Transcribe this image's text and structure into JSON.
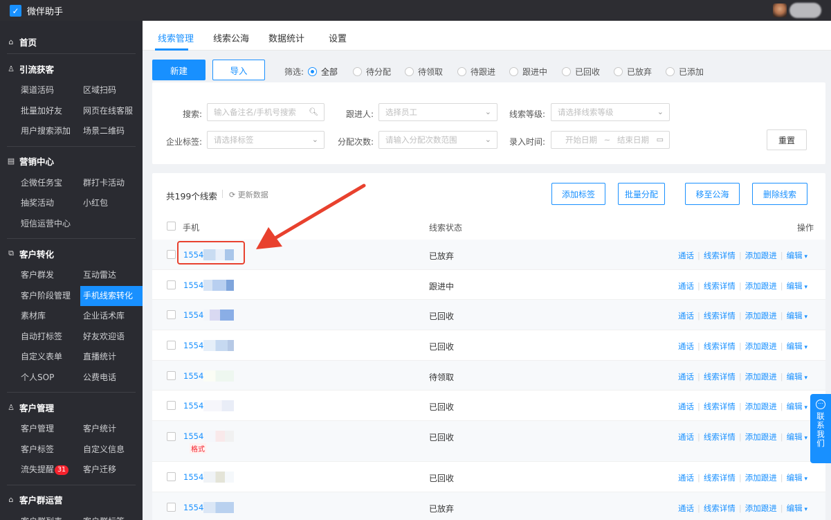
{
  "app": {
    "title": "微伴助手"
  },
  "sidebar": {
    "sections": [
      {
        "title": "首页",
        "icon": "home-icon",
        "items": []
      },
      {
        "title": "引流获客",
        "icon": "user-add-icon",
        "items": [
          "渠道活码",
          "区域扫码",
          "批量加好友",
          "网页在线客服",
          "用户搜索添加",
          "场景二维码"
        ]
      },
      {
        "title": "营销中心",
        "icon": "calendar-icon",
        "items": [
          "企微任务宝",
          "群打卡活动",
          "抽奖活动",
          "小红包",
          "短信运营中心"
        ]
      },
      {
        "title": "客户转化",
        "icon": "convert-icon",
        "items": [
          "客户群发",
          "互动雷达",
          "客户阶段管理",
          "手机线索转化",
          "素材库",
          "企业话术库",
          "自动打标签",
          "好友欢迎语",
          "自定义表单",
          "直播统计",
          "个人SOP",
          "公费电话"
        ]
      },
      {
        "title": "客户管理",
        "icon": "customer-icon",
        "items": [
          "客户管理",
          "客户统计",
          "客户标签",
          "自定义信息",
          "流失提醒",
          "客户迁移"
        ]
      },
      {
        "title": "客户群运营",
        "icon": "group-icon",
        "items": [
          "客户群列表",
          "客户群标签"
        ]
      }
    ],
    "active_item": "手机线索转化",
    "badge_item": "流失提醒",
    "badge_count": "31"
  },
  "tabs": [
    "线索管理",
    "线索公海",
    "数据统计",
    "设置"
  ],
  "toolbar": {
    "new_label": "新建",
    "import_label": "导入",
    "filter_label": "筛选:",
    "filters": [
      "全部",
      "待分配",
      "待领取",
      "待跟进",
      "跟进中",
      "已回收",
      "已放弃",
      "已添加"
    ],
    "selected_filter": "全部"
  },
  "search": {
    "search_label": "搜索:",
    "search_placeholder": "输入备注名/手机号搜索",
    "follower_label": "跟进人:",
    "follower_placeholder": "选择员工",
    "level_label": "线索等级:",
    "level_placeholder": "请选择线索等级",
    "tag_label": "企业标签:",
    "tag_placeholder": "请选择标签",
    "assign_label": "分配次数:",
    "assign_placeholder": "请输入分配次数范围",
    "time_label": "录入时间:",
    "start_placeholder": "开始日期",
    "range_sep": "~",
    "end_placeholder": "结束日期",
    "reset_label": "重置"
  },
  "table": {
    "total": "共199个线索",
    "refresh": "更新数据",
    "bulk_actions": [
      "添加标签",
      "批量分配",
      "移至公海",
      "删除线索"
    ],
    "headers": {
      "phone": "手机",
      "status": "线索状态",
      "ops": "操作"
    },
    "op_labels": [
      "通话",
      "线索详情",
      "添加跟进",
      "编辑"
    ],
    "rows": [
      {
        "phone": "15549",
        "status": "已放弃"
      },
      {
        "phone": "15549",
        "status": "跟进中"
      },
      {
        "phone": "15549",
        "status": "已回收"
      },
      {
        "phone": "15549",
        "status": "已回收"
      },
      {
        "phone": "15549",
        "status": "待领取"
      },
      {
        "phone": "15549",
        "status": "已回收"
      },
      {
        "phone": "15549",
        "status": "已回收",
        "tag": "格式"
      },
      {
        "phone": "1554",
        "status": "已回收"
      },
      {
        "phone": "15549",
        "status": "已放弃"
      }
    ]
  },
  "contact": {
    "label": "联系我们"
  },
  "colors": {
    "accent": "#1890ff",
    "sidebar_bg": "#2a2b31",
    "annotation": "#e8412e"
  }
}
